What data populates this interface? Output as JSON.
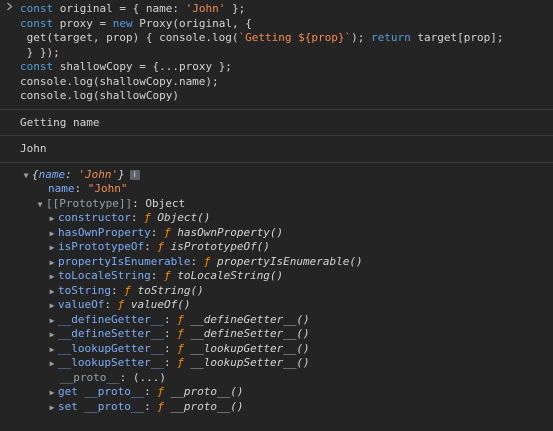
{
  "input": {
    "prompt_icon": "chevron-right-icon",
    "code": {
      "l1": {
        "kw": "const",
        "a": " original = { name: ",
        "s": "'John'",
        "b": " };"
      },
      "l2": {
        "kw": "const",
        "a": " proxy = ",
        "kw2": "new",
        "b": " Proxy(original, {"
      },
      "l3": {
        "a": " get(target, prop) { console.log(",
        "s": "`Getting ${prop}`",
        "b": "); ",
        "kw": "return",
        "c": " target[prop];"
      },
      "l4": {
        "a": " } });"
      },
      "l5": {
        "kw": "const",
        "a": " shallowCopy = {...proxy };"
      },
      "l6": {
        "a": "console.log(shallowCopy.name);"
      },
      "l7": {
        "a": "console.log(shallowCopy)"
      }
    }
  },
  "logs": {
    "getting_name": "Getting name",
    "john": "John"
  },
  "object": {
    "preview_open": "{",
    "preview_key": "name",
    "preview_colon": ": ",
    "preview_value": "'John'",
    "preview_close": "}",
    "info_glyph": "i",
    "name_key": "name",
    "name_value": "\"John\"",
    "prototype_label": "[[Prototype]]",
    "prototype_value": "Object",
    "proto_members": [
      {
        "key": "constructor",
        "f": "ƒ",
        "name": "Object()"
      },
      {
        "key": "hasOwnProperty",
        "f": "ƒ",
        "name": "hasOwnProperty()"
      },
      {
        "key": "isPrototypeOf",
        "f": "ƒ",
        "name": "isPrototypeOf()"
      },
      {
        "key": "propertyIsEnumerable",
        "f": "ƒ",
        "name": "propertyIsEnumerable()"
      },
      {
        "key": "toLocaleString",
        "f": "ƒ",
        "name": "toLocaleString()"
      },
      {
        "key": "toString",
        "f": "ƒ",
        "name": "toString()"
      },
      {
        "key": "valueOf",
        "f": "ƒ",
        "name": "valueOf()"
      },
      {
        "key": "__defineGetter__",
        "f": "ƒ",
        "name": "__defineGetter__()"
      },
      {
        "key": "__defineSetter__",
        "f": "ƒ",
        "name": "__defineSetter__()"
      },
      {
        "key": "__lookupGetter__",
        "f": "ƒ",
        "name": "__lookupGetter__()"
      },
      {
        "key": "__lookupSetter__",
        "f": "ƒ",
        "name": "__lookupSetter__()"
      }
    ],
    "proto_accessor": {
      "key": "__proto__",
      "value": "(...)"
    },
    "getter": {
      "prefix": "get",
      "key": "__proto__",
      "f": "ƒ",
      "name": "__proto__()"
    },
    "setter": {
      "prefix": "set",
      "key": "__proto__",
      "f": "ƒ",
      "name": "__proto__()"
    }
  },
  "colors": {
    "background": "#242424",
    "keyword": "#569cd6",
    "string": "#f28b54",
    "property": "#7cacf8",
    "function_marker": "#ff8c00"
  }
}
